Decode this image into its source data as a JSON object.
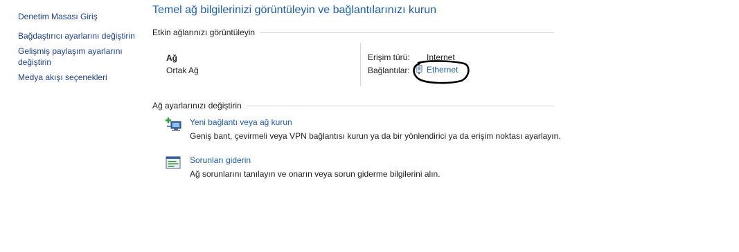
{
  "sidebar": {
    "items": [
      {
        "label": "Denetim Masası Giriş"
      },
      {
        "label": "Bağdaştırıcı ayarlarını değiştirin"
      },
      {
        "label": "Gelişmiş paylaşım ayarlarını değiştirin"
      },
      {
        "label": "Medya akışı seçenekleri"
      }
    ]
  },
  "main": {
    "title": "Temel ağ bilgilerinizi görüntüleyin ve bağlantılarınızı kurun",
    "active_networks": {
      "heading": "Etkin ağlarınızı görüntüleyin",
      "network_name": "Ağ",
      "network_type": "Ortak Ağ",
      "access_type_label": "Erişim türü:",
      "access_type_value": "Internet",
      "connections_label": "Bağlantılar:",
      "connection_value": "Ethernet"
    },
    "change_settings": {
      "heading": "Ağ ayarlarınızı değiştirin",
      "tasks": [
        {
          "link": "Yeni bağlantı veya ağ kurun",
          "description": "Geniş bant, çevirmeli veya VPN bağlantısı kurun ya da bir yönlendirici ya da erişim noktası ayarlayın.",
          "icon": "new-connection-icon"
        },
        {
          "link": "Sorunları giderin",
          "description": "Ağ sorunlarını tanılayın ve onarın veya sorun giderme bilgilerini alın.",
          "icon": "troubleshoot-icon"
        }
      ]
    }
  },
  "colors": {
    "title": "#1c5cb5",
    "link": "#1c5cb5",
    "sidebar_link": "#1c3f95",
    "rule": "#cfcfcf"
  }
}
